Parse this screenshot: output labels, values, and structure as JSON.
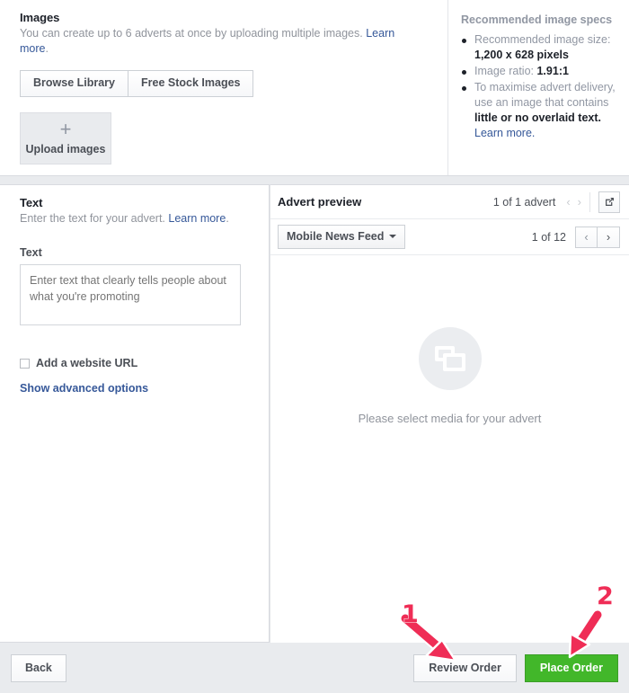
{
  "images_section": {
    "title": "Images",
    "description": "You can create up to 6 adverts at once by uploading multiple images.",
    "learn_more": "Learn more",
    "period": ".",
    "browse_library_label": "Browse Library",
    "free_stock_label": "Free Stock Images",
    "upload_label": "Upload images",
    "upload_icon": "plus-icon"
  },
  "specs": {
    "title": "Recommended image specs",
    "items": [
      {
        "prefix": "Recommended image size: ",
        "strong": "1,200 x 628 pixels",
        "suffix": ""
      },
      {
        "prefix": "Image ratio: ",
        "strong": "1.91:1",
        "suffix": ""
      },
      {
        "prefix": "To maximise advert delivery, use an image that contains ",
        "strong": "little or no overlaid text.",
        "suffix": " "
      }
    ],
    "learn_more": "Learn more."
  },
  "text_section": {
    "title": "Text",
    "description": "Enter the text for your advert.",
    "learn_more": "Learn more",
    "period": ".",
    "field_label": "Text",
    "textarea_value": "",
    "textarea_placeholder": "Enter text that clearly tells people about what you're promoting",
    "checkbox_label": "Add a website URL",
    "checkbox_checked": false,
    "advanced_link": "Show advanced options"
  },
  "preview": {
    "title": "Advert preview",
    "advert_count": "1 of 1 advert",
    "prev_icon": "chevron-left-icon",
    "next_icon": "chevron-right-icon",
    "expand_icon": "external-link-icon",
    "placement_label": "Mobile News Feed",
    "placement_caret": "chevron-down-icon",
    "page_count": "1 of 12",
    "media_icon": "media-placeholder-icon",
    "empty_message": "Please select media for your advert"
  },
  "footer": {
    "back_label": "Back",
    "review_label": "Review Order",
    "place_label": "Place Order",
    "place_color": "#42b72a"
  },
  "annotations": {
    "color": "#ef2d56",
    "markers": [
      {
        "number": "1",
        "target": "review-order-button"
      },
      {
        "number": "2",
        "target": "place-order-button"
      }
    ]
  }
}
